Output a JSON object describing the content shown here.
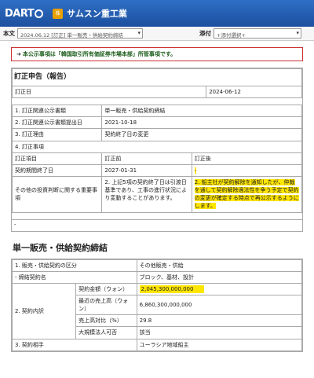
{
  "header": {
    "logo": "DART",
    "company_badge": "株",
    "company_name": "サムスン重工業"
  },
  "toolbar": {
    "doc_label": "本文",
    "doc_select": "2024.06.12 [訂正] 単一販売・供給契約締結",
    "attach_label": "添付",
    "attach_select": "+添付選択+"
  },
  "notice": {
    "arrow": "➜",
    "text": "本公示事項は「韓国取引所有価証券市場本部」所管事項です。"
  },
  "correction": {
    "title": "訂正申告（報告）",
    "date_label": "訂正日",
    "date_value": "2024-06-12",
    "rows": [
      {
        "label": "1. 訂正関連公示書類",
        "value": "単一販売・供給契約締結"
      },
      {
        "label": "2. 訂正関連公示書類提出日",
        "value": "2021-10-18"
      },
      {
        "label": "3. 訂正理由",
        "value": "契約終了日の変更"
      },
      {
        "label": "4. 訂正事項",
        "value": ""
      }
    ],
    "head": {
      "item": "訂正項目",
      "before": "訂正前",
      "after": "訂正後"
    },
    "item1": {
      "label": "契約期間終了日",
      "before": "2027-01-31",
      "after": "-"
    },
    "item2": {
      "label": "その他の投資判断に関する重要事項",
      "before": "2. 上記5項の契約終了日は引渡日基準であり、工事の進行状況により変動することがあります。",
      "after": "2. 船主社が契約解除を通知したが、仲裁を通して契約解除適法性を争う予定で契約の変更が確定する時点で再公示するようにします。"
    }
  },
  "empty_box": "-",
  "main": {
    "title": "単一販売・供給契約締結",
    "r1": {
      "label": "1. 販売・供給契約の区分",
      "value": "その他販売・供給"
    },
    "r1b": {
      "label": "- 締結契約名",
      "value": "ブロック、基材、設計"
    },
    "r2": {
      "label": "2. 契約内訳",
      "sub": [
        {
          "label": "契約金額（ウォン）",
          "value": "2,045,300,000,000"
        },
        {
          "label": "最近の売上高（ウォン）",
          "value": "6,860,300,000,000"
        },
        {
          "label": "売上高対比（%）",
          "value": "29.8"
        },
        {
          "label": "大規模法人可否",
          "value": "該当"
        }
      ]
    },
    "r3": {
      "label": "3. 契約相手",
      "value": "ユーラシア地域船主"
    }
  },
  "colors": {
    "header": "#2f6fc6",
    "highlight": "#ffe600",
    "notice_border": "#cc3333",
    "notice_text": "#1a5c1a"
  }
}
